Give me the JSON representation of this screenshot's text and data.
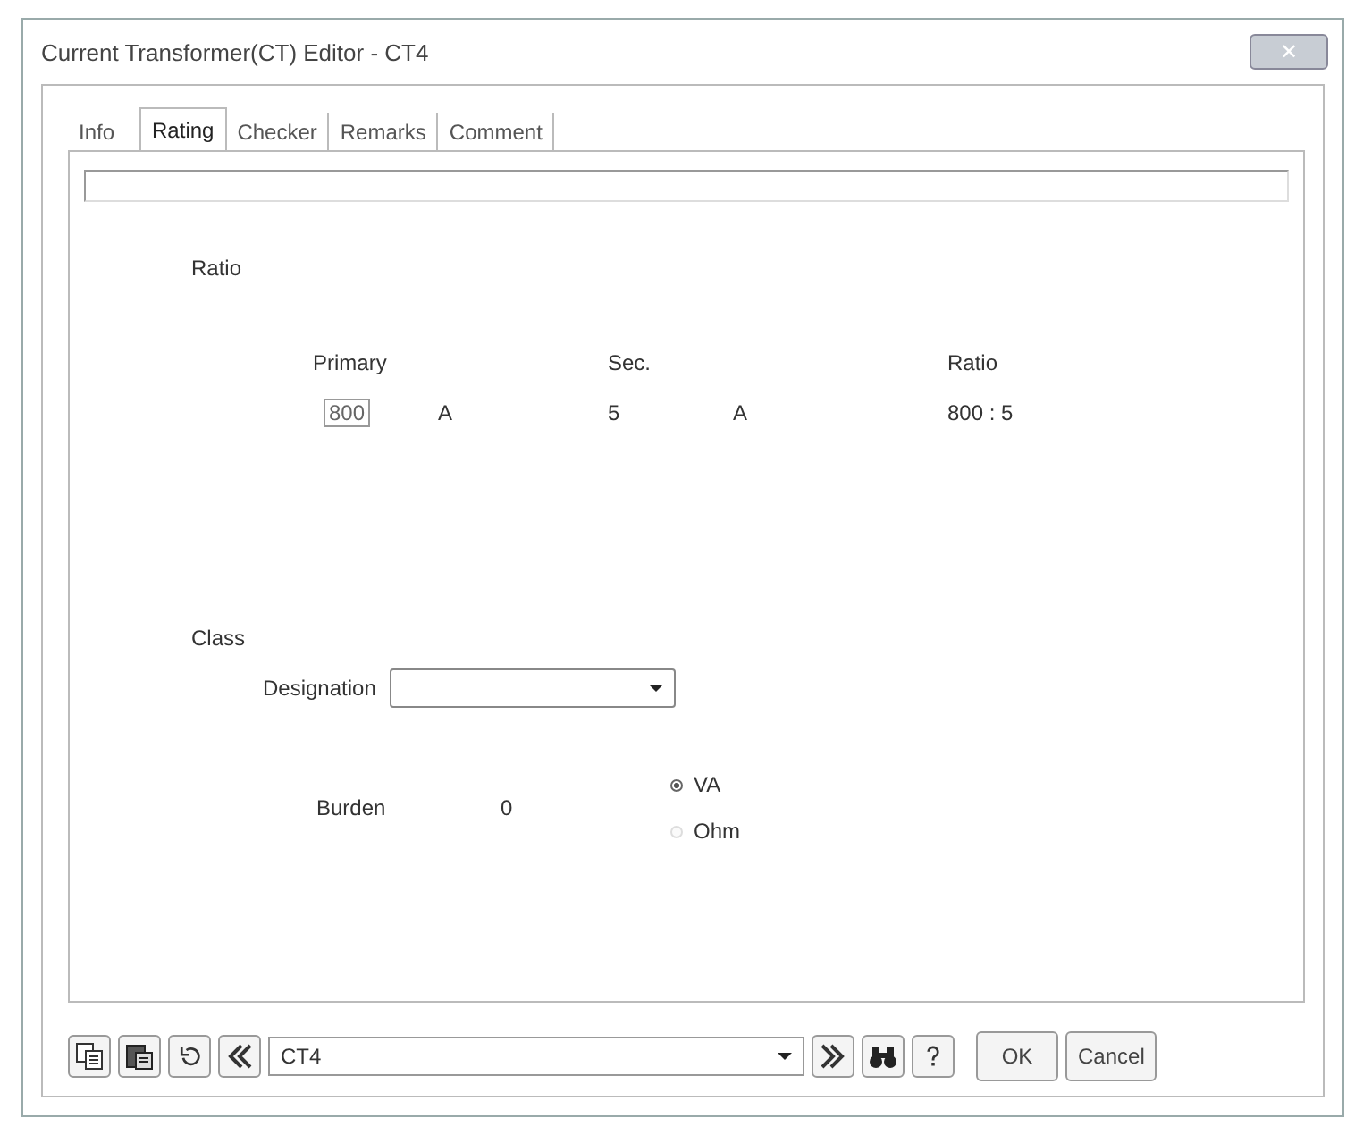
{
  "window": {
    "title": "Current Transformer(CT) Editor - CT4",
    "close": "✕"
  },
  "tabs": [
    {
      "label": "Info",
      "selected": false
    },
    {
      "label": "Rating",
      "selected": true
    },
    {
      "label": "Checker",
      "selected": false
    },
    {
      "label": "Remarks",
      "selected": false
    },
    {
      "label": "Comment",
      "selected": false
    }
  ],
  "ratio": {
    "heading": "Ratio",
    "primary_label": "Primary",
    "primary_value": "800",
    "primary_unit": "A",
    "sec_label": "Sec.",
    "sec_value": "5",
    "sec_unit": "A",
    "ratio_label": "Ratio",
    "ratio_value": "800 : 5"
  },
  "class": {
    "heading": "Class",
    "designation_label": "Designation",
    "burden_label": "Burden",
    "burden_value": "0",
    "units": [
      {
        "label": "VA",
        "selected": true
      },
      {
        "label": "Ohm",
        "selected": false
      }
    ]
  },
  "toolbar": {
    "record": "CT4",
    "ok": "OK",
    "cancel": "Cancel"
  }
}
